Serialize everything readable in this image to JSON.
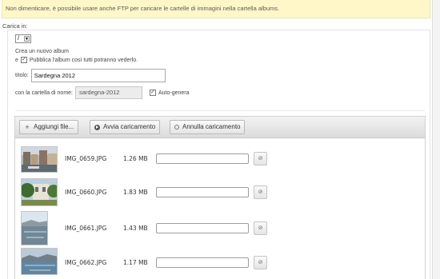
{
  "notice": "Non dimenticare, è possibile usare anche FTP per caricare le cartelle di immagini nella cartella albums.",
  "upload_in_label": "Carica in:",
  "folder_select": {
    "value": "/"
  },
  "new_album": {
    "label": "Crea un nuovo album",
    "publish_prefix": "e",
    "publish_label": "Pubblica l'album così tutti potranno vederlo.",
    "publish_checked": true
  },
  "title_field": {
    "label": "titolo:",
    "value": "Sardegna 2012"
  },
  "folder_field": {
    "label": "con la cartella di nome:",
    "value": "sardegna-2012",
    "auto_label": "Auto-genera",
    "auto_checked": true
  },
  "toolbar": {
    "add_files": "Aggiungi file...",
    "start_upload": "Avvia caricamento",
    "cancel_upload": "Annulla caricamento"
  },
  "files": [
    {
      "name": "IMG_0659.JPG",
      "size": "1.26 MB",
      "progress": 0,
      "thumb": "harbor-icon"
    },
    {
      "name": "IMG_0660.JPG",
      "size": "1.83 MB",
      "progress": 0,
      "thumb": "garden-icon"
    },
    {
      "name": "IMG_0661.JPG",
      "size": "1.43 MB",
      "progress": 0,
      "thumb": "sea-icon"
    },
    {
      "name": "IMG_0662.JPG",
      "size": "1.17 MB",
      "progress": 0,
      "thumb": "coast-icon"
    }
  ],
  "colors": {
    "notice_bg": "#fff7c8",
    "toolbar_bg": "#e6e6e6",
    "progress_fill": "#6aa84f"
  }
}
